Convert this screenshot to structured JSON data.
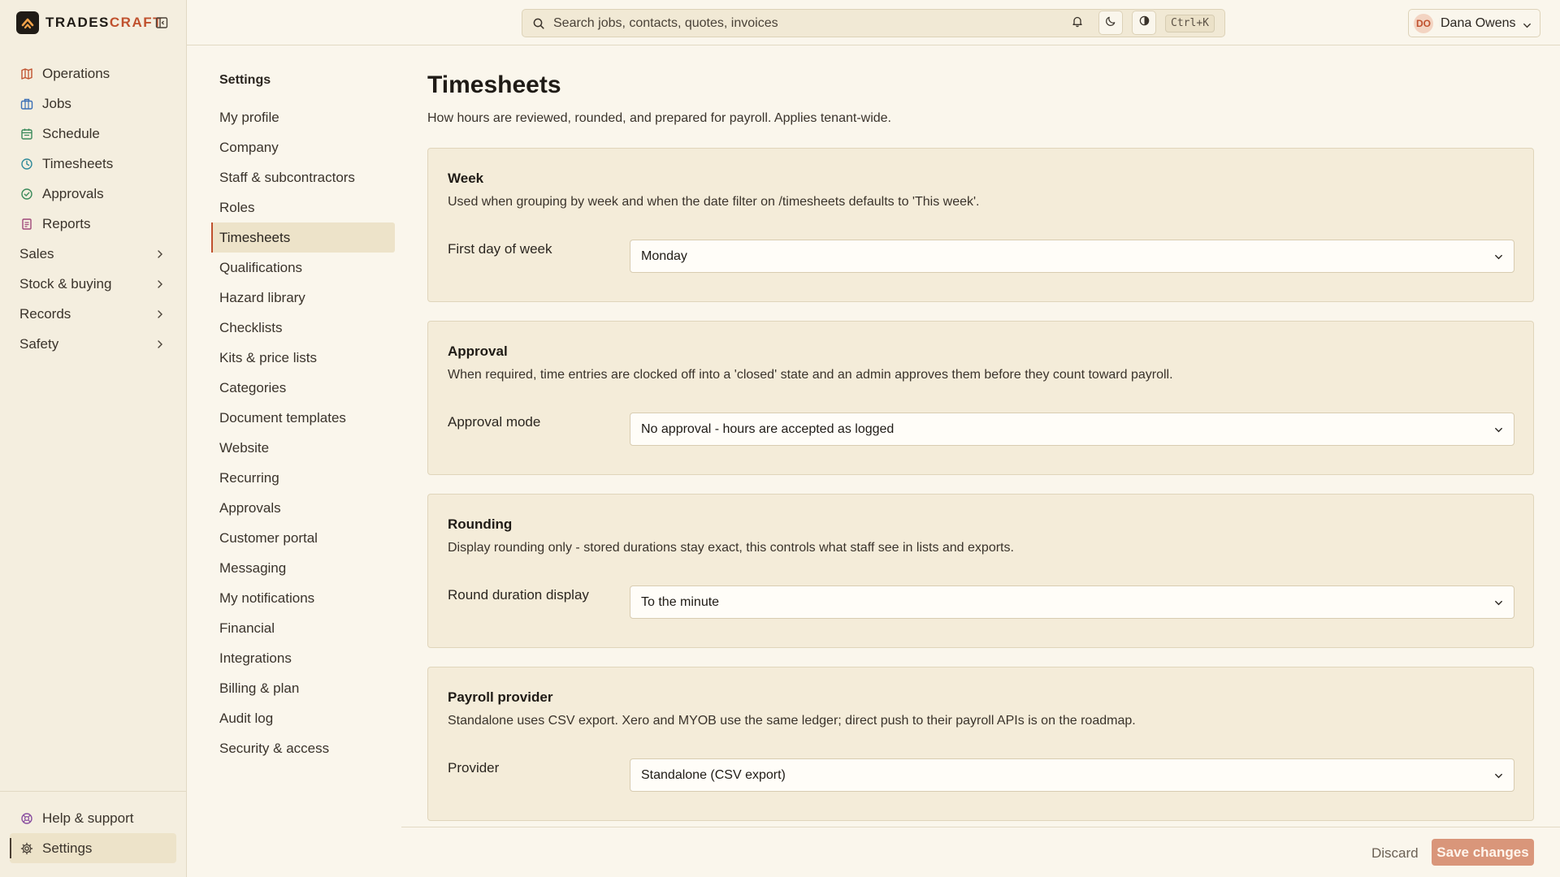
{
  "brand": {
    "name_part1": "TRADES",
    "name_part2": "CRAFT"
  },
  "sidebar": {
    "items": [
      {
        "label": "Operations",
        "icon": "map-icon",
        "color": "#c0512e"
      },
      {
        "label": "Jobs",
        "icon": "briefcase-icon",
        "color": "#3b6fb6"
      },
      {
        "label": "Schedule",
        "icon": "calendar-icon",
        "color": "#3a8a5a"
      },
      {
        "label": "Timesheets",
        "icon": "clock-icon",
        "color": "#2f8a9a"
      },
      {
        "label": "Approvals",
        "icon": "check-circle-icon",
        "color": "#3a8a5a"
      },
      {
        "label": "Reports",
        "icon": "report-icon",
        "color": "#a0487a"
      }
    ],
    "groups": [
      {
        "label": "Sales"
      },
      {
        "label": "Stock & buying"
      },
      {
        "label": "Records"
      },
      {
        "label": "Safety"
      }
    ],
    "bottom": [
      {
        "label": "Help & support",
        "icon": "help-icon"
      },
      {
        "label": "Settings",
        "icon": "gear-icon"
      }
    ]
  },
  "topbar": {
    "search_placeholder": "Search jobs, contacts, quotes, invoices",
    "shortcut": "Ctrl+K",
    "user_initials": "DO",
    "user_name": "Dana Owens"
  },
  "settings_nav": {
    "title": "Settings",
    "items": [
      "My profile",
      "Company",
      "Staff & subcontractors",
      "Roles",
      "Timesheets",
      "Qualifications",
      "Hazard library",
      "Checklists",
      "Kits & price lists",
      "Categories",
      "Document templates",
      "Website",
      "Recurring",
      "Approvals",
      "Customer portal",
      "Messaging",
      "My notifications",
      "Financial",
      "Integrations",
      "Billing & plan",
      "Audit log",
      "Security & access"
    ],
    "active": "Timesheets"
  },
  "page": {
    "title": "Timesheets",
    "subtitle": "How hours are reviewed, rounded, and prepared for payroll. Applies tenant-wide."
  },
  "sections": [
    {
      "title": "Week",
      "description": "Used when grouping by week and when the date filter on /timesheets defaults to 'This week'.",
      "field_label": "First day of week",
      "value": "Monday"
    },
    {
      "title": "Approval",
      "description": "When required, time entries are clocked off into a 'closed' state and an admin approves them before they count toward payroll.",
      "field_label": "Approval mode",
      "value": "No approval - hours are accepted as logged"
    },
    {
      "title": "Rounding",
      "description": "Display rounding only - stored durations stay exact, this controls what staff see in lists and exports.",
      "field_label": "Round duration display",
      "value": "To the minute"
    },
    {
      "title": "Payroll provider",
      "description": "Standalone uses CSV export. Xero and MYOB use the same ledger; direct push to their payroll APIs is on the roadmap.",
      "field_label": "Provider",
      "value": "Standalone (CSV export)"
    }
  ],
  "footer": {
    "discard_label": "Discard",
    "save_label": "Save changes"
  },
  "colors": {
    "accent": "#c0512e",
    "background": "#faf6ec",
    "card": "#f4ecd9"
  }
}
